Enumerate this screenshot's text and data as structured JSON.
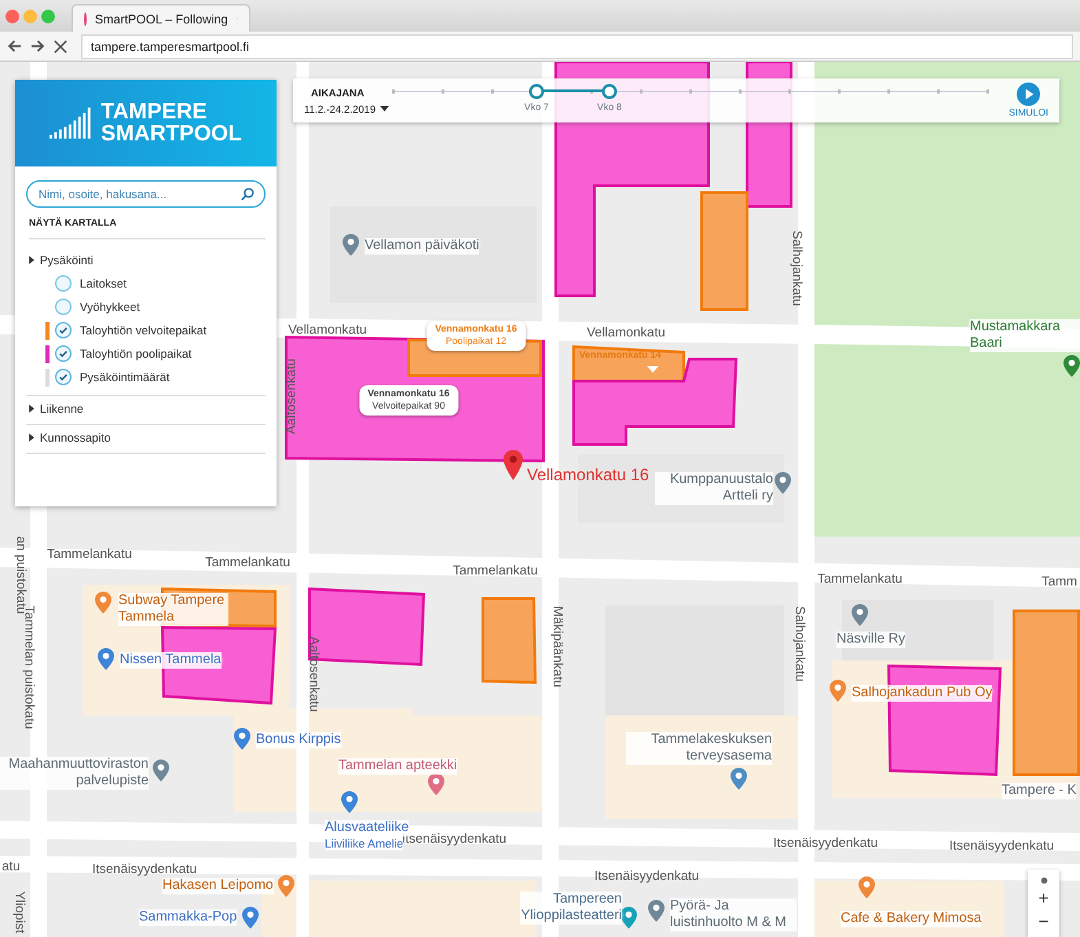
{
  "browser": {
    "tab_title": "SmartPOOL – Following",
    "url": "tampere.tamperesmartpool.fi"
  },
  "sidebar": {
    "logo": [
      "TAMPERE",
      "SMARTPOOL"
    ],
    "search": {
      "placeholder": "Nimi, osoite, hakusana..."
    },
    "section_title": "NÄYTÄ KARTALLA",
    "groups": [
      {
        "label": "Pysäköinti",
        "items": [
          {
            "label": "Laitokset",
            "checked": false
          },
          {
            "label": "Vyöhykkeet",
            "checked": false
          },
          {
            "label": "Taloyhtiön velvoitepaikat",
            "checked": true,
            "color": "#f5891f"
          },
          {
            "label": "Taloyhtiön poolipaikat",
            "checked": true,
            "color": "#e02bbd"
          },
          {
            "label": "Pysäköintimäärät",
            "checked": true,
            "color": "#dcdcdc"
          }
        ]
      },
      {
        "label": "Liikenne"
      },
      {
        "label": "Kunnossapito"
      }
    ]
  },
  "timeline": {
    "title": "AIKAJANA",
    "date_range": "11.2.-24.2.2019",
    "weeks": [
      {
        "label": "Vko 7",
        "selected": true
      },
      {
        "label": "Vko 8",
        "selected": true
      }
    ],
    "button": "SIMULOI"
  },
  "map": {
    "parking_areas": [
      {
        "kind": "pooli"
      },
      {
        "kind": "pooli"
      },
      {
        "kind": "velvoite"
      },
      {
        "kind": "pooli"
      },
      {
        "kind": "velvoite"
      },
      {
        "kind": "velvoite"
      },
      {
        "kind": "pooli"
      },
      {
        "kind": "velvoite"
      },
      {
        "kind": "pooli"
      },
      {
        "kind": "pooli"
      },
      {
        "kind": "velvoite"
      },
      {
        "kind": "pooli"
      },
      {
        "kind": "velvoite"
      }
    ],
    "streets": [
      "Vellamonkatu",
      "Vellamonkatu",
      "Salhojankatu",
      "Aaltosenkatu",
      "an puistokatu",
      "Tammelankatu",
      "Tammelankatu",
      "Tammelankatu",
      "Tammelankatu",
      "Tamm",
      "Tammelan puistokatu",
      "Aaltosenkatu",
      "Mäkipäänkatu",
      "Salhojankatu",
      "Itsenäisyydenkatu",
      "Itsenäisyydenkatu",
      "Itsenäisyydenkatu",
      "atu",
      "Itsenäisyydenkatu",
      "Itsenäisyydenkatu",
      "Yliopist"
    ],
    "places": [
      {
        "name": "Vellamon päiväkoti",
        "kind": "poi"
      },
      {
        "name": "Mustamakkara Baari",
        "kind": "bar"
      },
      {
        "name": "Kumppanuustalo Artteli ry",
        "kind": "poi"
      },
      {
        "name": "Subway Tampere Tammela",
        "kind": "restaurant"
      },
      {
        "name": "Nissen Tammela",
        "kind": "shop"
      },
      {
        "name": "Bonus Kirppis",
        "kind": "shop"
      },
      {
        "name": "Maahanmuuttoviraston palvelupiste",
        "kind": "poi"
      },
      {
        "name": "Tammelan apteekki",
        "kind": "pharmacy"
      },
      {
        "name": "Alusvaateliike",
        "subtitle": "Liiviliike Amelie",
        "kind": "shop"
      },
      {
        "name": "Tammelakeskuksen terveysasema",
        "kind": "health"
      },
      {
        "name": "Näsville Ry",
        "kind": "poi"
      },
      {
        "name": "Salhojankadun Pub Oy",
        "kind": "restaurant"
      },
      {
        "name": "Tampere - K",
        "kind": "label"
      },
      {
        "name": "Hakasen Leipomo",
        "kind": "restaurant"
      },
      {
        "name": "Sammakka-Pop",
        "kind": "shop"
      },
      {
        "name": "Tampereen Ylioppilasteatteri",
        "kind": "theatre"
      },
      {
        "name": "Pyörä- Ja luistinhuolto M & M",
        "kind": "poi"
      },
      {
        "name": "Cafe & Bakery Mimosa",
        "kind": "restaurant"
      }
    ],
    "popups": [
      {
        "title": "Vennamonkatu 16",
        "subtitle": "Poolipaikat 12",
        "kind": "pooli"
      },
      {
        "title": "Vennamonkatu 16",
        "subtitle": "Velvoitepaikat 90",
        "kind": "velvoite"
      }
    ],
    "area_tags": [
      "Vennamonkatu 14"
    ],
    "marker": {
      "label": "Vellamonkatu 16"
    },
    "zoom_controls": [
      "+",
      "−"
    ]
  }
}
